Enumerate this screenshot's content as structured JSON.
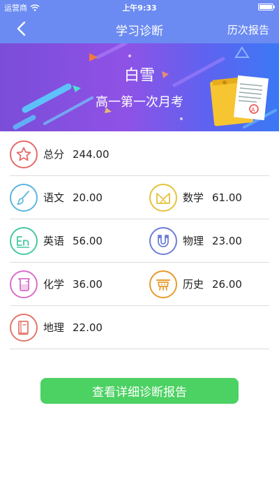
{
  "status_bar": {
    "carrier": "运营商",
    "time": "上午9:33"
  },
  "nav": {
    "title": "学习诊断",
    "history_label": "历次报告"
  },
  "banner": {
    "student_name": "白雪",
    "exam_name": "高一第一次月考"
  },
  "scores": {
    "total": {
      "label": "总分",
      "value": "244.00",
      "icon": "star-icon",
      "color": "#e36b6b"
    },
    "chinese": {
      "label": "语文",
      "value": "20.00",
      "icon": "brush-icon",
      "color": "#5ab6de"
    },
    "math": {
      "label": "数学",
      "value": "61.00",
      "icon": "compass-icon",
      "color": "#e6c23c"
    },
    "english": {
      "label": "英语",
      "value": "56.00",
      "icon": "en-icon",
      "color": "#45c9a4"
    },
    "physics": {
      "label": "物理",
      "value": "23.00",
      "icon": "magnet-icon",
      "color": "#6d7fd6"
    },
    "chemistry": {
      "label": "化学",
      "value": "36.00",
      "icon": "beaker-icon",
      "color": "#d86fc9"
    },
    "history": {
      "label": "历史",
      "value": "26.00",
      "icon": "ding-icon",
      "color": "#e89a2e"
    },
    "geography": {
      "label": "地理",
      "value": "22.00",
      "icon": "book-icon",
      "color": "#e0786b"
    }
  },
  "detail_button_label": "查看详细诊断报告"
}
